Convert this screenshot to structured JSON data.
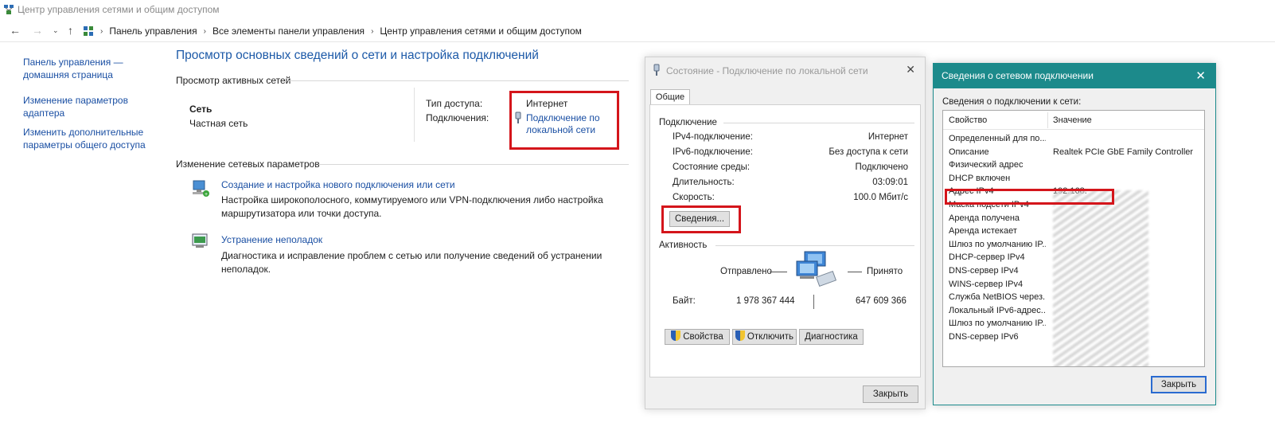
{
  "window": {
    "title": "Центр управления сетями и общим доступом",
    "breadcrumb": [
      "Панель управления",
      "Все элементы панели управления",
      "Центр управления сетями и общим доступом"
    ]
  },
  "sidebar": {
    "items": [
      {
        "label": "Панель управления — домашняя страница"
      },
      {
        "label": "Изменение параметров адаптера"
      },
      {
        "label": "Изменить дополнительные параметры общего доступа"
      }
    ]
  },
  "main": {
    "title": "Просмотр основных сведений о сети и настройка подключений",
    "active_networks_heading": "Просмотр активных сетей",
    "network_name": "Сеть",
    "network_type": "Частная сеть",
    "access_type_label": "Тип доступа:",
    "access_type_value": "Интернет",
    "connections_label": "Подключения:",
    "connection_link": "Подключение по локальной сети",
    "change_settings_heading": "Изменение сетевых параметров",
    "task1_title": "Создание и настройка нового подключения или сети",
    "task1_desc": "Настройка широкополосного, коммутируемого или VPN-подключения либо настройка маршрутизатора или точки доступа.",
    "task2_title": "Устранение неполадок",
    "task2_desc": "Диагностика и исправление проблем с сетью или получение сведений об устранении неполадок."
  },
  "status_dialog": {
    "title": "Состояние - Подключение по локальной сети",
    "tab": "Общие",
    "connection_heading": "Подключение",
    "rows": [
      {
        "label": "IPv4-подключение:",
        "value": "Интернет"
      },
      {
        "label": "IPv6-подключение:",
        "value": "Без доступа к сети"
      },
      {
        "label": "Состояние среды:",
        "value": "Подключено"
      },
      {
        "label": "Длительность:",
        "value": "03:09:01"
      },
      {
        "label": "Скорость:",
        "value": "100.0 Мбит/с"
      }
    ],
    "details_button": "Сведения...",
    "activity_heading": "Активность",
    "sent_label": "Отправлено",
    "received_label": "Принято",
    "bytes_label": "Байт:",
    "bytes_sent": "1 978 367 444",
    "bytes_received": "647 609 366",
    "properties_button": "Свойства",
    "disable_button": "Отключить",
    "diagnose_button": "Диагностика",
    "close_button": "Закрыть"
  },
  "details_dialog": {
    "title": "Сведения о сетевом подключении",
    "subtitle": "Сведения о подключении к сети:",
    "col_property": "Свойство",
    "col_value": "Значение",
    "rows": [
      {
        "p": "Определенный для по...",
        "v": ""
      },
      {
        "p": "Описание",
        "v": "Realtek PCIe GbE Family Controller"
      },
      {
        "p": "Физический адрес",
        "v": ""
      },
      {
        "p": "DHCP включен",
        "v": ""
      },
      {
        "p": "Адрес IPv4",
        "v": "192.168."
      },
      {
        "p": "Маска подсети IPv4",
        "v": ""
      },
      {
        "p": "Аренда получена",
        "v": ""
      },
      {
        "p": "Аренда истекает",
        "v": ""
      },
      {
        "p": "Шлюз по умолчанию IP...",
        "v": ""
      },
      {
        "p": "DHCP-сервер IPv4",
        "v": ""
      },
      {
        "p": "DNS-сервер IPv4",
        "v": ""
      },
      {
        "p": "WINS-сервер IPv4",
        "v": ""
      },
      {
        "p": "Служба NetBIOS через...",
        "v": ""
      },
      {
        "p": "Локальный IPv6-адрес...",
        "v": ""
      },
      {
        "p": "Шлюз по умолчанию IP...",
        "v": ""
      },
      {
        "p": "DNS-сервер IPv6",
        "v": ""
      }
    ],
    "close_button": "Закрыть"
  },
  "colors": {
    "link": "#1a4fa3",
    "title_blue": "#1d5aa8",
    "highlight_red": "#d4151b",
    "dialog_titlebar": "#1c8a8b"
  },
  "icons": [
    "network-center-icon",
    "back-arrow-icon",
    "forward-arrow-icon",
    "recent-dropdown-icon",
    "up-arrow-icon",
    "control-panel-icon",
    "ethernet-plug-icon",
    "new-connection-icon",
    "troubleshoot-icon",
    "computers-network-icon",
    "shield-icon",
    "close-icon"
  ]
}
